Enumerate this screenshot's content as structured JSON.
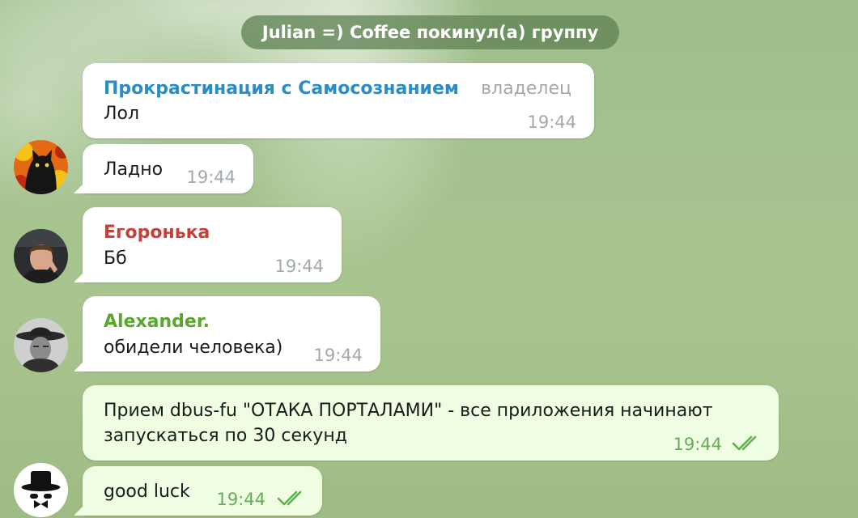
{
  "service_message": "Julian =) Coffee покинул(а) группу",
  "colors": {
    "sender_blue": "#2a8dc4",
    "sender_red": "#c4403a",
    "sender_green": "#5ba72e",
    "time_gray": "#a2a9ae",
    "time_green": "#65ad56",
    "bubble_in": "#ffffff",
    "bubble_out": "#effde2"
  },
  "messages": [
    {
      "sender": "Прокрастинация с Самосознанием",
      "role": "владелец",
      "text": "Лол",
      "time": "19:44"
    },
    {
      "text": "Ладно",
      "time": "19:44",
      "avatar": "cat-avatar"
    },
    {
      "sender": "Егоронька",
      "text": "Бб",
      "time": "19:44",
      "avatar": "person-avatar"
    },
    {
      "sender": "Alexander.",
      "text": "обидели человека)",
      "time": "19:44",
      "avatar": "cowboy-avatar"
    },
    {
      "text": "Прием dbus-fu \"ОТАКА ПОРТАЛАМИ\" - все приложения начинают",
      "text2": "запускаться по 30 секунд",
      "time": "19:44",
      "status": "read-double-check-icon"
    },
    {
      "text": "good luck",
      "time": "19:44",
      "status": "read-double-check-icon",
      "avatar": "gentleman-avatar"
    }
  ]
}
